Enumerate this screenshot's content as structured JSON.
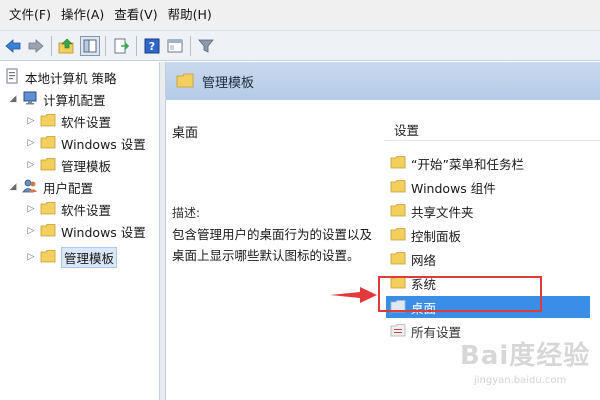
{
  "menubar": {
    "items": [
      "文件(F)",
      "操作(A)",
      "查看(V)",
      "帮助(H)"
    ]
  },
  "toolbar": {
    "buttons": [
      "back-icon",
      "forward-icon",
      "up-folder-icon",
      "show-hide-tree-icon",
      "export-list-icon",
      "help-icon",
      "properties-icon",
      "filter-icon"
    ]
  },
  "tree": {
    "items": [
      {
        "label": "本地计算机 策略",
        "icon": "policy-icon",
        "expander": ""
      },
      {
        "label": "计算机配置",
        "icon": "computer-icon",
        "expander": "◢"
      },
      {
        "label": "软件设置",
        "icon": "folder-icon",
        "expander": "▷"
      },
      {
        "label": "Windows 设置",
        "icon": "folder-icon",
        "expander": "▷"
      },
      {
        "label": "管理模板",
        "icon": "folder-icon",
        "expander": "▷"
      },
      {
        "label": "用户配置",
        "icon": "user-icon",
        "expander": "◢"
      },
      {
        "label": "软件设置",
        "icon": "folder-icon",
        "expander": "▷"
      },
      {
        "label": "Windows 设置",
        "icon": "folder-icon",
        "expander": "▷"
      },
      {
        "label": "管理模板",
        "icon": "folder-icon",
        "expander": "▷",
        "selected": true
      }
    ]
  },
  "content": {
    "header_title": "管理模板",
    "selected_title": "桌面",
    "description_label": "描述:",
    "description_text": "包含管理用户的桌面行为的设置以及桌面上显示哪些默认图标的设置。",
    "list_header": "设置",
    "list_items": [
      {
        "label": "“开始”菜单和任务栏",
        "icon": "folder-icon"
      },
      {
        "label": "Windows 组件",
        "icon": "folder-icon"
      },
      {
        "label": "共享文件夹",
        "icon": "folder-icon"
      },
      {
        "label": "控制面板",
        "icon": "folder-icon"
      },
      {
        "label": "网络",
        "icon": "folder-icon"
      },
      {
        "label": "系统",
        "icon": "folder-icon"
      },
      {
        "label": "桌面",
        "icon": "folder-icon",
        "selected": true
      },
      {
        "label": "所有设置",
        "icon": "settings-folder-icon"
      }
    ]
  },
  "colors": {
    "accent_selection": "#3a8ee6",
    "annotation_red": "#e23a3a",
    "header_blue": "#c9d9ee",
    "folder_yellow": "#f3cf5e"
  },
  "watermark": {
    "main": "Bai度经验",
    "sub": "jingyan.baidu.com"
  }
}
